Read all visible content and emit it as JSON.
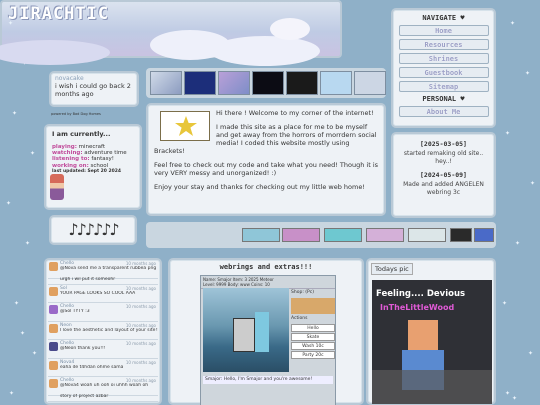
{
  "site": {
    "title": "JIRACHTIC"
  },
  "status": {
    "username": "novacake",
    "message": "i wish i could go back 2 months ago",
    "powered": "powered by Bad Dog Homes"
  },
  "welcome": {
    "p1": "Hi there ! Welcome to my corner of the internet!",
    "p2": "I made this site as a place for me to be myself and get away from the horrors of morrdern social media! I coded this website mostly using Brackets!",
    "p3": "Feel free to check out my code and take what you need! Though it is very VERY messy and unorganized! :)",
    "p4": "Enjoy your stay and thanks for checking out my little web home!"
  },
  "currently": {
    "heading": "I am currently...",
    "items": [
      {
        "k": "playing:",
        "v": " minecraft"
      },
      {
        "k": "watching:",
        "v": " adventure time"
      },
      {
        "k": "listening to:",
        "v": " fantasy!"
      },
      {
        "k": "working on:",
        "v": " school"
      }
    ],
    "updated": "last updated: Sept 20 2024"
  },
  "notes": "♪♪♪♪♪♪",
  "nav": {
    "heading": "NAVIGATE",
    "items": [
      "Home",
      "Resources",
      "Shrines",
      "Guestbook",
      "Sitemap"
    ],
    "personal": "PERSONAL",
    "about": "About Me"
  },
  "updates": [
    {
      "date": "[2025-03-05]",
      "text": "started remaking old site.. hey..!"
    },
    {
      "date": "[2024-05-09]",
      "text": "Made and added ANGELEN webring 3c"
    }
  ],
  "chat": [
    {
      "name": "Chello",
      "time": "10 months ago",
      "text": "@Nova send me a transparent rubbea png"
    },
    {
      "name": "",
      "time": "",
      "text": "urgh i wil put it someohr"
    },
    {
      "name": "Sol",
      "time": "10 months ago",
      "text": "YOUR PAGE LOOKS SO COOL AAA"
    },
    {
      "name": "Chello",
      "time": "10 months ago",
      "text": "@Sol TYTY :3"
    },
    {
      "name": "Neon",
      "time": "10 months ago",
      "text": "I love the aesthetic and layout of your site!! so pretty :)"
    },
    {
      "name": "Chello",
      "time": "10 months ago",
      "text": "@Neon thank you!!!"
    },
    {
      "name": "Nova4",
      "time": "10 months ago",
      "text": "eaha de t4hdan ohme sama"
    },
    {
      "name": "Chello",
      "time": "10 months ago",
      "text": "@Nova4 woah uh ooh oi uhhh woah oh"
    },
    {
      "name": "",
      "time": "",
      "text": "story of project azbar"
    }
  ],
  "webrings": {
    "title": "webrings and extras!!!",
    "game": {
      "header": "Name: Smajor   Item: 3 2025   Meteor",
      "header2": "Level: 9999   Body: www   Coins: 10",
      "shop": "Shop: (Pc)",
      "actions": "Actions",
      "buttons": [
        "Hello",
        "Skate",
        "Wash 10c",
        "Party 20c"
      ],
      "dialog": "Smajor: Hello, I'm Smajor and you're awesome!"
    }
  },
  "today": {
    "label": "Todays pic",
    "caption1": "Feeling.... Devious",
    "caption2": "InTheLittleWood"
  },
  "colors": {
    "accent": "#c04a9a",
    "nav_text": "#9b9fc6",
    "background": "#8fb0c8"
  }
}
